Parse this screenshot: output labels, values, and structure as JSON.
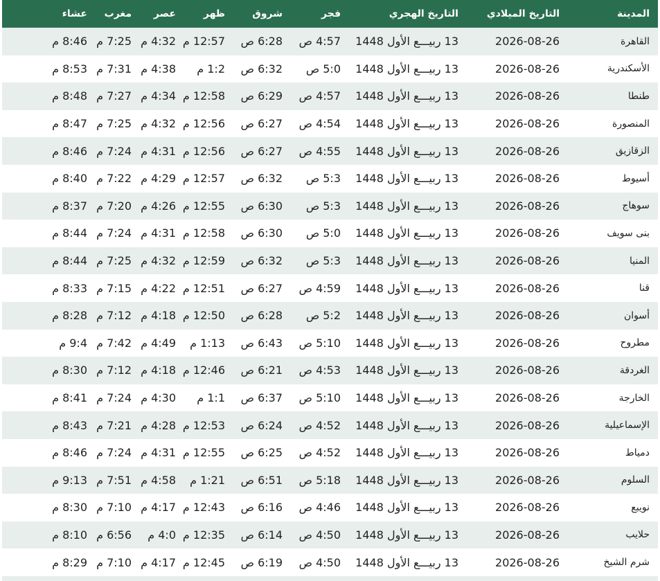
{
  "header": {
    "city": "المدينة",
    "gregorian": "التاريخ الميلادي",
    "hijri": "التاريخ الهجري",
    "fajr": "فجر",
    "shuruq": "شروق",
    "dhuhr": "ظهر",
    "asr": "عصر",
    "maghrib": "مغرب",
    "isha": "عشاء"
  },
  "rows": [
    {
      "city": "القاهرة",
      "gregorian": "2026-08-26",
      "hijri": "13 ربيـــع الأول 1448",
      "fajr": "4:57 ص",
      "shuruq": "6:28 ص",
      "dhuhr": "12:57 م",
      "asr": "4:32 م",
      "maghrib": "7:25 م",
      "isha": "8:46 م"
    },
    {
      "city": "الأسكندرية",
      "gregorian": "2026-08-26",
      "hijri": "13 ربيـــع الأول 1448",
      "fajr": "5:0 ص",
      "shuruq": "6:32 ص",
      "dhuhr": "1:2 م",
      "asr": "4:38 م",
      "maghrib": "7:31 م",
      "isha": "8:53 م"
    },
    {
      "city": "طنطا",
      "gregorian": "2026-08-26",
      "hijri": "13 ربيـــع الأول 1448",
      "fajr": "4:57 ص",
      "shuruq": "6:29 ص",
      "dhuhr": "12:58 م",
      "asr": "4:34 م",
      "maghrib": "7:27 م",
      "isha": "8:48 م"
    },
    {
      "city": "المنصورة",
      "gregorian": "2026-08-26",
      "hijri": "13 ربيـــع الأول 1448",
      "fajr": "4:54 ص",
      "shuruq": "6:27 ص",
      "dhuhr": "12:56 م",
      "asr": "4:32 م",
      "maghrib": "7:25 م",
      "isha": "8:47 م"
    },
    {
      "city": "الزقازيق",
      "gregorian": "2026-08-26",
      "hijri": "13 ربيـــع الأول 1448",
      "fajr": "4:55 ص",
      "shuruq": "6:27 ص",
      "dhuhr": "12:56 م",
      "asr": "4:31 م",
      "maghrib": "7:24 م",
      "isha": "8:46 م"
    },
    {
      "city": "أسيوط",
      "gregorian": "2026-08-26",
      "hijri": "13 ربيـــع الأول 1448",
      "fajr": "5:3 ص",
      "shuruq": "6:32 ص",
      "dhuhr": "12:57 م",
      "asr": "4:29 م",
      "maghrib": "7:22 م",
      "isha": "8:40 م"
    },
    {
      "city": "سوهاج",
      "gregorian": "2026-08-26",
      "hijri": "13 ربيـــع الأول 1448",
      "fajr": "5:3 ص",
      "shuruq": "6:30 ص",
      "dhuhr": "12:55 م",
      "asr": "4:26 م",
      "maghrib": "7:20 م",
      "isha": "8:37 م"
    },
    {
      "city": "بنى سويف",
      "gregorian": "2026-08-26",
      "hijri": "13 ربيـــع الأول 1448",
      "fajr": "5:0 ص",
      "shuruq": "6:30 ص",
      "dhuhr": "12:58 م",
      "asr": "4:31 م",
      "maghrib": "7:24 م",
      "isha": "8:44 م"
    },
    {
      "city": "المنيا",
      "gregorian": "2026-08-26",
      "hijri": "13 ربيـــع الأول 1448",
      "fajr": "5:3 ص",
      "shuruq": "6:32 ص",
      "dhuhr": "12:59 م",
      "asr": "4:32 م",
      "maghrib": "7:25 م",
      "isha": "8:44 م"
    },
    {
      "city": "قنا",
      "gregorian": "2026-08-26",
      "hijri": "13 ربيـــع الأول 1448",
      "fajr": "4:59 ص",
      "shuruq": "6:27 ص",
      "dhuhr": "12:51 م",
      "asr": "4:22 م",
      "maghrib": "7:15 م",
      "isha": "8:33 م"
    },
    {
      "city": "أسوان",
      "gregorian": "2026-08-26",
      "hijri": "13 ربيـــع الأول 1448",
      "fajr": "5:2 ص",
      "shuruq": "6:28 ص",
      "dhuhr": "12:50 م",
      "asr": "4:18 م",
      "maghrib": "7:12 م",
      "isha": "8:28 م"
    },
    {
      "city": "مطروح",
      "gregorian": "2026-08-26",
      "hijri": "13 ربيـــع الأول 1448",
      "fajr": "5:10 ص",
      "shuruq": "6:43 ص",
      "dhuhr": "1:13 م",
      "asr": "4:49 م",
      "maghrib": "7:42 م",
      "isha": "9:4 م"
    },
    {
      "city": "الغردقة",
      "gregorian": "2026-08-26",
      "hijri": "13 ربيـــع الأول 1448",
      "fajr": "4:53 ص",
      "shuruq": "6:21 ص",
      "dhuhr": "12:46 م",
      "asr": "4:18 م",
      "maghrib": "7:12 م",
      "isha": "8:30 م"
    },
    {
      "city": "الخارجة",
      "gregorian": "2026-08-26",
      "hijri": "13 ربيـــع الأول 1448",
      "fajr": "5:10 ص",
      "shuruq": "6:37 ص",
      "dhuhr": "1:1 م",
      "asr": "4:30 م",
      "maghrib": "7:24 م",
      "isha": "8:41 م"
    },
    {
      "city": "الإسماعيلية",
      "gregorian": "2026-08-26",
      "hijri": "13 ربيـــع الأول 1448",
      "fajr": "4:52 ص",
      "shuruq": "6:24 ص",
      "dhuhr": "12:53 م",
      "asr": "4:28 م",
      "maghrib": "7:21 م",
      "isha": "8:43 م"
    },
    {
      "city": "دمياط",
      "gregorian": "2026-08-26",
      "hijri": "13 ربيـــع الأول 1448",
      "fajr": "4:52 ص",
      "shuruq": "6:25 ص",
      "dhuhr": "12:55 م",
      "asr": "4:31 م",
      "maghrib": "7:24 م",
      "isha": "8:46 م"
    },
    {
      "city": "السلوم",
      "gregorian": "2026-08-26",
      "hijri": "13 ربيـــع الأول 1448",
      "fajr": "5:18 ص",
      "shuruq": "6:51 ص",
      "dhuhr": "1:21 م",
      "asr": "4:58 م",
      "maghrib": "7:51 م",
      "isha": "9:13 م"
    },
    {
      "city": "نويبع",
      "gregorian": "2026-08-26",
      "hijri": "13 ربيـــع الأول 1448",
      "fajr": "4:46 ص",
      "shuruq": "6:16 ص",
      "dhuhr": "12:43 م",
      "asr": "4:17 م",
      "maghrib": "7:10 م",
      "isha": "8:30 م"
    },
    {
      "city": "حلايب",
      "gregorian": "2026-08-26",
      "hijri": "13 ربيـــع الأول 1448",
      "fajr": "4:50 ص",
      "shuruq": "6:14 ص",
      "dhuhr": "12:35 م",
      "asr": "4:0 م",
      "maghrib": "6:56 م",
      "isha": "8:10 م"
    },
    {
      "city": "شرم الشيخ",
      "gregorian": "2026-08-26",
      "hijri": "13 ربيـــع الأول 1448",
      "fajr": "4:50 ص",
      "shuruq": "6:19 ص",
      "dhuhr": "12:45 م",
      "asr": "4:17 م",
      "maghrib": "7:10 م",
      "isha": "8:29 م"
    }
  ],
  "colors": {
    "header_bg": "#2a6e50",
    "stripe": "#e7eeec",
    "text": "#222222"
  }
}
